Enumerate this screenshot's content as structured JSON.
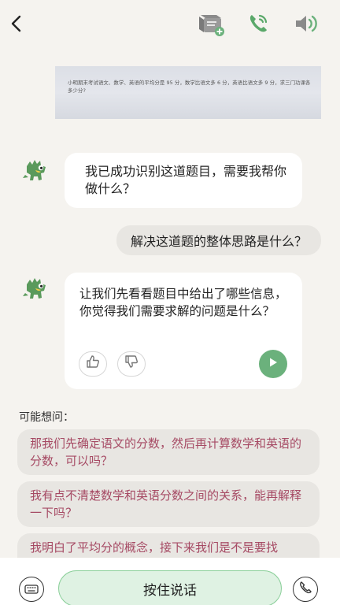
{
  "icons": {
    "back": "chevron-left-icon",
    "notebook": "notebook-add-icon",
    "call": "phone-call-icon",
    "speaker": "speaker-icon",
    "thumbs_up": "thumbs-up-icon",
    "thumbs_down": "thumbs-down-icon",
    "play": "play-icon",
    "keyboard": "keyboard-icon",
    "phone": "phone-icon"
  },
  "colors": {
    "accent_green": "#6bb17c",
    "suggestion_text": "#a64a64",
    "background": "#f5f3ef"
  },
  "question": {
    "text": "小明期末考试语文、数学、英语的平均分是 95 分，数学比语文多 6 分，英语比语文多 9 分，求三门功课各多少分?"
  },
  "messages": [
    {
      "role": "bot",
      "text": "我已成功识别这道题目，需要我帮你做什么？"
    },
    {
      "role": "user",
      "text": "解决这道题的整体思路是什么？"
    },
    {
      "role": "bot",
      "text": "让我们先看看题目中给出了哪些信息，你觉得我们需要求解的问题是什么？"
    }
  ],
  "suggestions": {
    "title": "可能想问：",
    "items": [
      "那我们先确定语文的分数，然后再计算数学和英语的分数，可以吗？",
      "我有点不清楚数学和英语分数之间的关系，能再解释一下吗？",
      "我明白了平均分的概念，接下来我们是不是要找"
    ]
  },
  "bottom": {
    "hold_label": "按住说话"
  }
}
